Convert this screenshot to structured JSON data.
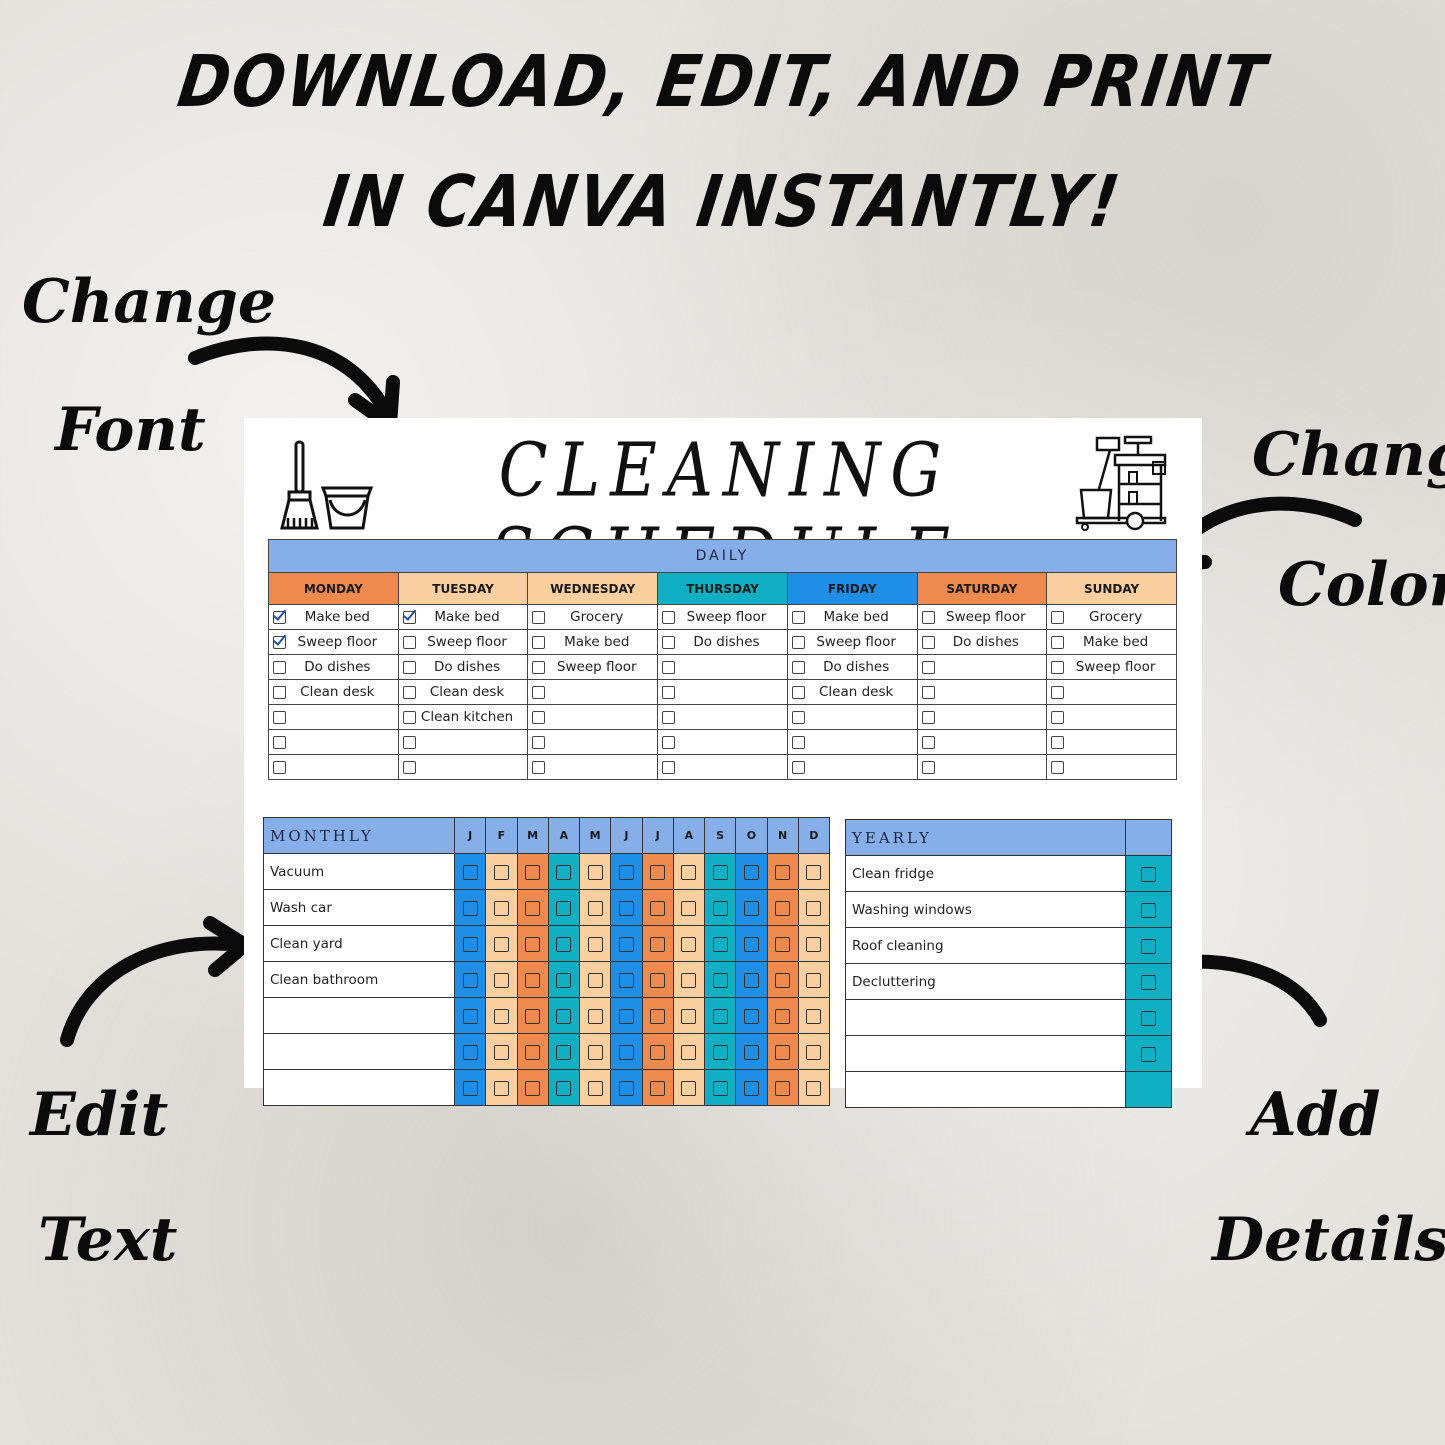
{
  "headline": {
    "line1": "DOWNLOAD, EDIT, AND PRINT",
    "line2": "IN CANVA INSTANTLY!"
  },
  "callouts": {
    "change_font": [
      "Change",
      "Font"
    ],
    "change_color": [
      "Change",
      "Color"
    ],
    "edit_text": [
      "Edit",
      "Text"
    ],
    "add_details": [
      "Add",
      "Details"
    ]
  },
  "icons": {
    "title_left": "broom-bucket-icon",
    "title_right": "cleaning-cart-icon",
    "callout_arrow": "curved-arrow-icon"
  },
  "colors": {
    "header_blue": "#86aee8",
    "orange": "#ef8a4e",
    "peach": "#f9cf9f",
    "teal": "#10afc4",
    "blue": "#1f8ee6",
    "check": "#1f4fa0"
  },
  "schedule": {
    "title": "CLEANING SCHEDULE",
    "daily": {
      "title": "DAILY",
      "days": [
        {
          "name": "MONDAY",
          "color": "orange",
          "tasks": [
            {
              "text": "Make bed",
              "checked": true
            },
            {
              "text": "Sweep floor",
              "checked": true
            },
            {
              "text": "Do dishes",
              "checked": false
            },
            {
              "text": "Clean desk",
              "checked": false
            },
            {
              "text": "",
              "checked": false
            },
            {
              "text": "",
              "checked": false
            },
            {
              "text": "",
              "checked": false
            }
          ]
        },
        {
          "name": "TUESDAY",
          "color": "peach",
          "tasks": [
            {
              "text": "Make bed",
              "checked": true
            },
            {
              "text": "Sweep floor",
              "checked": false
            },
            {
              "text": "Do dishes",
              "checked": false
            },
            {
              "text": "Clean desk",
              "checked": false
            },
            {
              "text": "Clean kitchen",
              "checked": false
            },
            {
              "text": "",
              "checked": false
            },
            {
              "text": "",
              "checked": false
            }
          ]
        },
        {
          "name": "WEDNESDAY",
          "color": "peach",
          "tasks": [
            {
              "text": "Grocery",
              "checked": false
            },
            {
              "text": "Make bed",
              "checked": false
            },
            {
              "text": "Sweep floor",
              "checked": false
            },
            {
              "text": "",
              "checked": false
            },
            {
              "text": "",
              "checked": false
            },
            {
              "text": "",
              "checked": false
            },
            {
              "text": "",
              "checked": false
            }
          ]
        },
        {
          "name": "THURSDAY",
          "color": "teal",
          "tasks": [
            {
              "text": "Sweep floor",
              "checked": false
            },
            {
              "text": "Do dishes",
              "checked": false
            },
            {
              "text": "",
              "checked": false
            },
            {
              "text": "",
              "checked": false
            },
            {
              "text": "",
              "checked": false
            },
            {
              "text": "",
              "checked": false
            },
            {
              "text": "",
              "checked": false
            }
          ]
        },
        {
          "name": "FRIDAY",
          "color": "blue",
          "tasks": [
            {
              "text": "Make bed",
              "checked": false
            },
            {
              "text": "Sweep floor",
              "checked": false
            },
            {
              "text": "Do dishes",
              "checked": false
            },
            {
              "text": "Clean desk",
              "checked": false
            },
            {
              "text": "",
              "checked": false
            },
            {
              "text": "",
              "checked": false
            },
            {
              "text": "",
              "checked": false
            }
          ]
        },
        {
          "name": "SATURDAY",
          "color": "orange",
          "tasks": [
            {
              "text": "Sweep floor",
              "checked": false
            },
            {
              "text": "Do dishes",
              "checked": false
            },
            {
              "text": "",
              "checked": false
            },
            {
              "text": "",
              "checked": false
            },
            {
              "text": "",
              "checked": false
            },
            {
              "text": "",
              "checked": false
            },
            {
              "text": "",
              "checked": false
            }
          ]
        },
        {
          "name": "SUNDAY",
          "color": "peach",
          "tasks": [
            {
              "text": "Grocery",
              "checked": false
            },
            {
              "text": "Make bed",
              "checked": false
            },
            {
              "text": "Sweep floor",
              "checked": false
            },
            {
              "text": "",
              "checked": false
            },
            {
              "text": "",
              "checked": false
            },
            {
              "text": "",
              "checked": false
            },
            {
              "text": "",
              "checked": false
            }
          ]
        }
      ]
    },
    "monthly": {
      "title": "MONTHLY",
      "months": [
        {
          "label": "J",
          "color": "blue"
        },
        {
          "label": "F",
          "color": "peach"
        },
        {
          "label": "M",
          "color": "orange"
        },
        {
          "label": "A",
          "color": "teal"
        },
        {
          "label": "M",
          "color": "peach"
        },
        {
          "label": "J",
          "color": "blue"
        },
        {
          "label": "J",
          "color": "orange"
        },
        {
          "label": "A",
          "color": "peach"
        },
        {
          "label": "S",
          "color": "teal"
        },
        {
          "label": "O",
          "color": "blue"
        },
        {
          "label": "N",
          "color": "orange"
        },
        {
          "label": "D",
          "color": "peach"
        }
      ],
      "tasks": [
        "Vacuum",
        "Wash car",
        "Clean yard",
        "Clean bathroom",
        "",
        "",
        ""
      ]
    },
    "yearly": {
      "title": "YEARLY",
      "column_color": "teal",
      "tasks": [
        "Clean fridge",
        "Washing windows",
        "Roof cleaning",
        "Decluttering",
        "",
        "",
        ""
      ]
    }
  }
}
